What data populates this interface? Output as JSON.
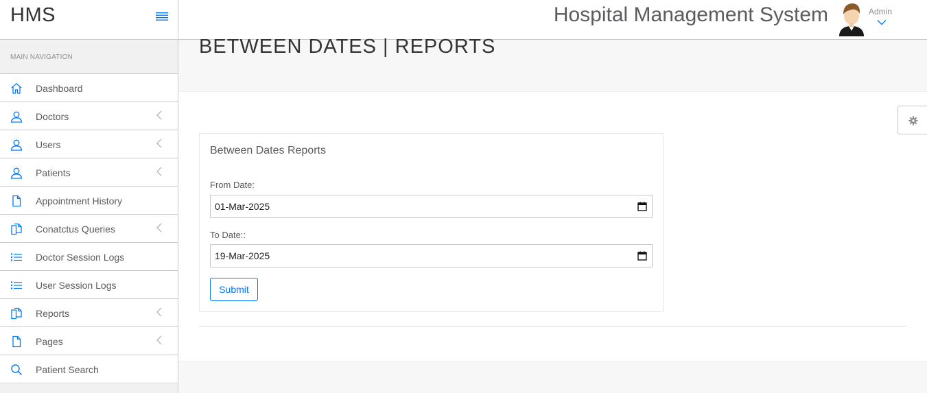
{
  "brand": "HMS",
  "app_title": "Hospital Management System",
  "user": {
    "name": "Admin"
  },
  "nav": {
    "header": "MAIN NAVIGATION",
    "items": [
      {
        "label": "Dashboard",
        "icon": "home-icon",
        "has_submenu": false
      },
      {
        "label": "Doctors",
        "icon": "user-icon",
        "has_submenu": true
      },
      {
        "label": "Users",
        "icon": "user-icon",
        "has_submenu": true
      },
      {
        "label": "Patients",
        "icon": "user-icon",
        "has_submenu": true
      },
      {
        "label": "Appointment History",
        "icon": "file-icon",
        "has_submenu": false
      },
      {
        "label": "Conatctus Queries",
        "icon": "files-icon",
        "has_submenu": true
      },
      {
        "label": "Doctor Session Logs",
        "icon": "list-icon",
        "has_submenu": false
      },
      {
        "label": "User Session Logs",
        "icon": "list-icon",
        "has_submenu": false
      },
      {
        "label": "Reports",
        "icon": "files-icon",
        "has_submenu": true
      },
      {
        "label": "Pages",
        "icon": "file-icon",
        "has_submenu": true
      },
      {
        "label": "Patient Search",
        "icon": "search-icon",
        "has_submenu": false
      }
    ]
  },
  "page": {
    "title": "BETWEEN DATES | REPORTS"
  },
  "form": {
    "title": "Between Dates Reports",
    "from_label": "From Date:",
    "from_value": "01-Mar-2025",
    "to_label": "To Date::",
    "to_value": "19-Mar-2025",
    "submit_label": "Submit"
  },
  "colors": {
    "accent": "#007aff",
    "border": "#c8c7cc",
    "text": "#5b5b60"
  }
}
